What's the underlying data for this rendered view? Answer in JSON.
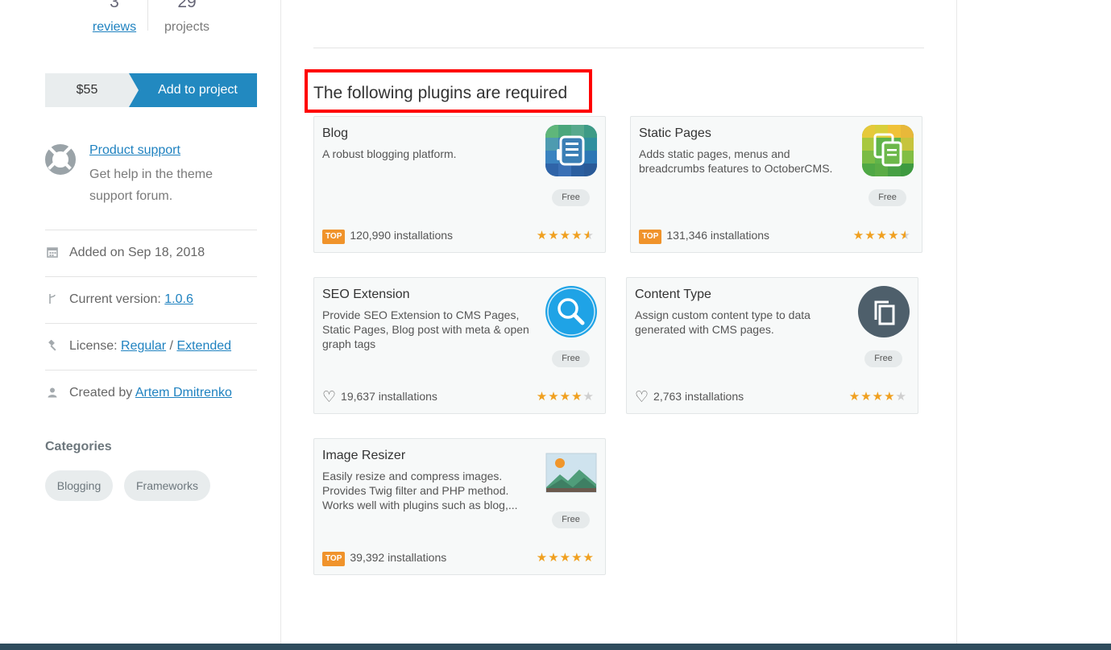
{
  "sidebar": {
    "stats": {
      "reviews_count": "3",
      "reviews_label": "reviews",
      "projects_count": "29",
      "projects_label": "projects"
    },
    "price": "$55",
    "add_button": "Add to project",
    "support": {
      "link": "Product support",
      "description": "Get help in the theme support forum."
    },
    "added_prefix": "Added on Sep 18, 2018",
    "version_prefix": "Current version:",
    "version": "1.0.6",
    "license_prefix": "License:",
    "license_regular": "Regular",
    "license_sep": "/",
    "license_extended": "Extended",
    "created_prefix": "Created by",
    "author": "Artem Dmitrenko",
    "categories_title": "Categories",
    "categories": [
      "Blogging",
      "Frameworks"
    ]
  },
  "main": {
    "required_title": "The following plugins are required",
    "plugins": [
      {
        "name": "Blog",
        "description": "A robust blogging platform.",
        "price": "Free",
        "badge": "TOP",
        "installations": "120,990 installations",
        "rating": 4.5,
        "icon": "blog-icon"
      },
      {
        "name": "Static Pages",
        "description": "Adds static pages, menus and breadcrumbs features to OctoberCMS.",
        "price": "Free",
        "badge": "TOP",
        "installations": "131,346 installations",
        "rating": 4.5,
        "icon": "static-pages-icon"
      },
      {
        "name": "SEO Extension",
        "description": "Provide SEO Extension to CMS Pages, Static Pages, Blog post with meta & open graph tags",
        "price": "Free",
        "badge": "heart",
        "installations": "19,637 installations",
        "rating": 4,
        "icon": "magnifier-icon"
      },
      {
        "name": "Content Type",
        "description": "Assign custom content type to data generated with CMS pages.",
        "price": "Free",
        "badge": "heart",
        "installations": "2,763 installations",
        "rating": 4,
        "icon": "copy-icon"
      },
      {
        "name": "Image Resizer",
        "description": "Easily resize and compress images. Provides Twig filter and PHP method. Works well with plugins such as blog,...",
        "price": "Free",
        "badge": "TOP",
        "installations": "39,392 installations",
        "rating": 5,
        "icon": "image-icon"
      }
    ]
  },
  "colors": {
    "accent": "#2289c0",
    "link": "#1f82c0",
    "star": "#f0a020",
    "top_badge": "#f0932b",
    "highlight_box": "#ff0000",
    "footer": "#2f4c5d"
  }
}
